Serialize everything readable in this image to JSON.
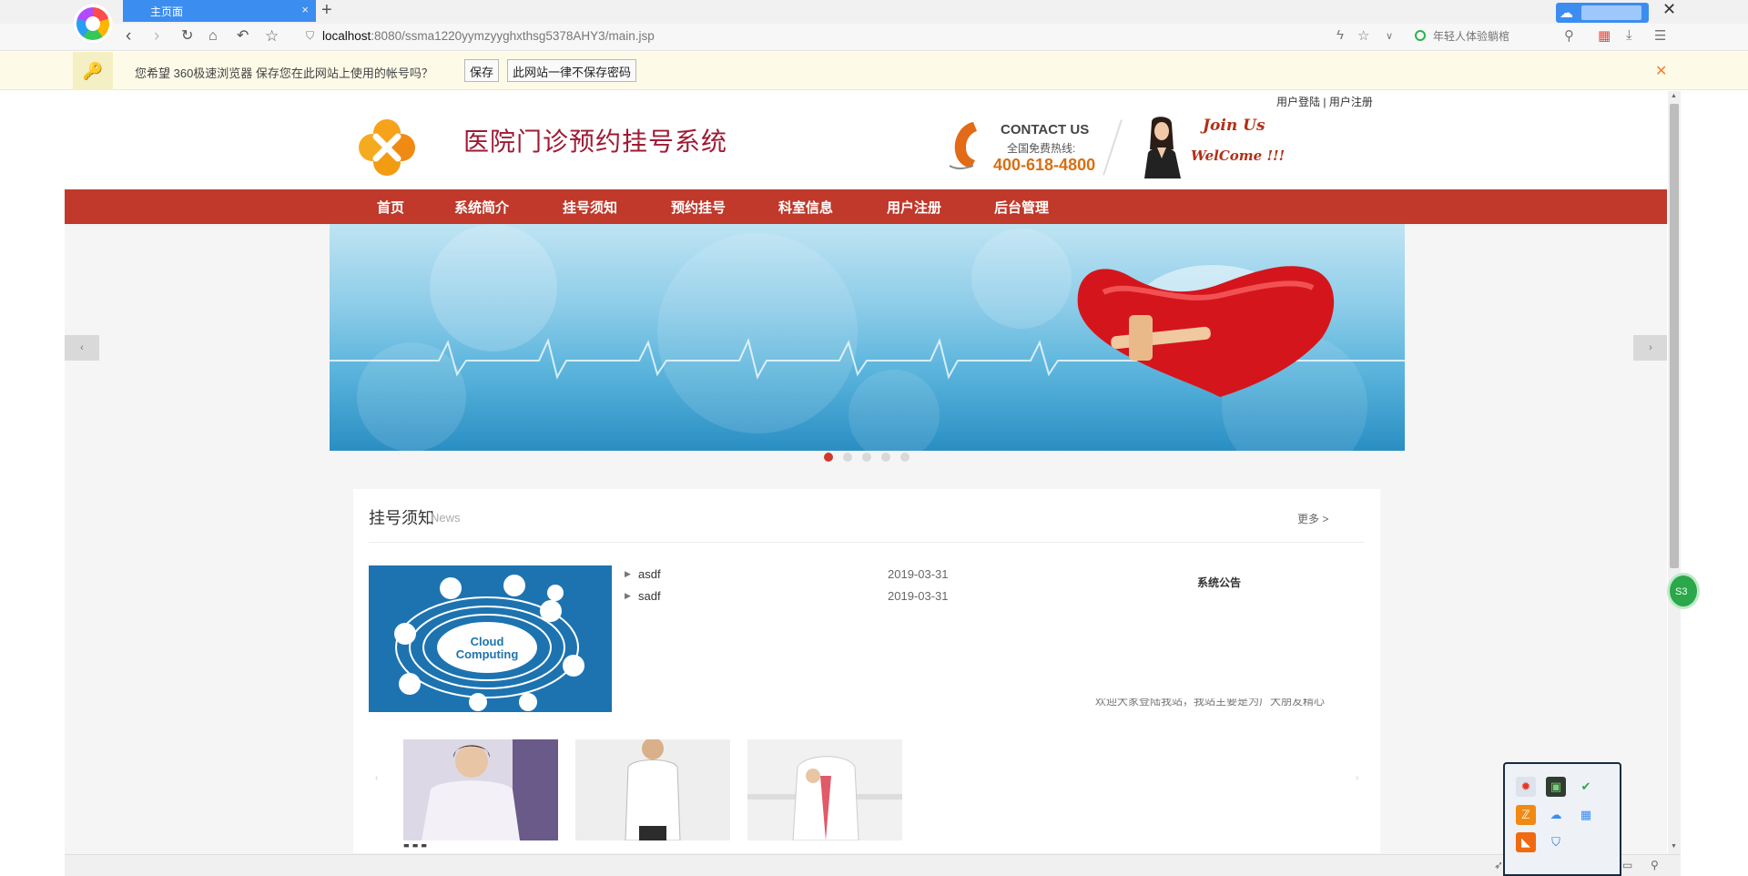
{
  "browser": {
    "tab_title": "主页面",
    "tab_close": "×",
    "new_tab": "+",
    "url_host": "localhost",
    "url_path": ":8080/ssma1220yymzyyghxthsg5378AHY3/main.jsp",
    "search_placeholder": "年轻人体验躺棺",
    "window_close": "✕"
  },
  "password_bar": {
    "message": "您希望 360极速浏览器 保存您在此网站上使用的帐号吗？",
    "save_label": "保存",
    "never_label": "此网站一律不保存密码",
    "close": "✕"
  },
  "header": {
    "login": "用户登陆",
    "separator": "|",
    "register": "用户注册",
    "site_title": "医院门诊预约挂号系统",
    "contact_title": "CONTACT US",
    "contact_sub": "全国免费热线:",
    "contact_phone": "400-618-4800",
    "join_us": "Join Us",
    "welcome": "WelCome !!!"
  },
  "nav": {
    "items": [
      "首页",
      "系统简介",
      "挂号须知",
      "预约挂号",
      "科室信息",
      "用户注册",
      "后台管理"
    ]
  },
  "banner": {
    "prev": "‹",
    "next": "›",
    "slide_count": 5,
    "active_slide": 1
  },
  "news": {
    "title": "挂号须知",
    "subtitle": "News",
    "more": "更多 >",
    "image_text_1": "Cloud",
    "image_text_2": "Computing",
    "items": [
      {
        "title": "asdf",
        "date": "2019-03-31"
      },
      {
        "title": "sadf",
        "date": "2019-03-31"
      }
    ],
    "notice_title": "系统公告",
    "notice_text": "欢迎大家登陆我站，我站主要是为广大朋友精心"
  },
  "doctors": {
    "prev": "‹",
    "next": "›"
  },
  "colors": {
    "nav_red": "#c0392b",
    "title_red": "#9e1b34",
    "phone_orange": "#d86f11",
    "tab_blue": "#3c8df0"
  }
}
